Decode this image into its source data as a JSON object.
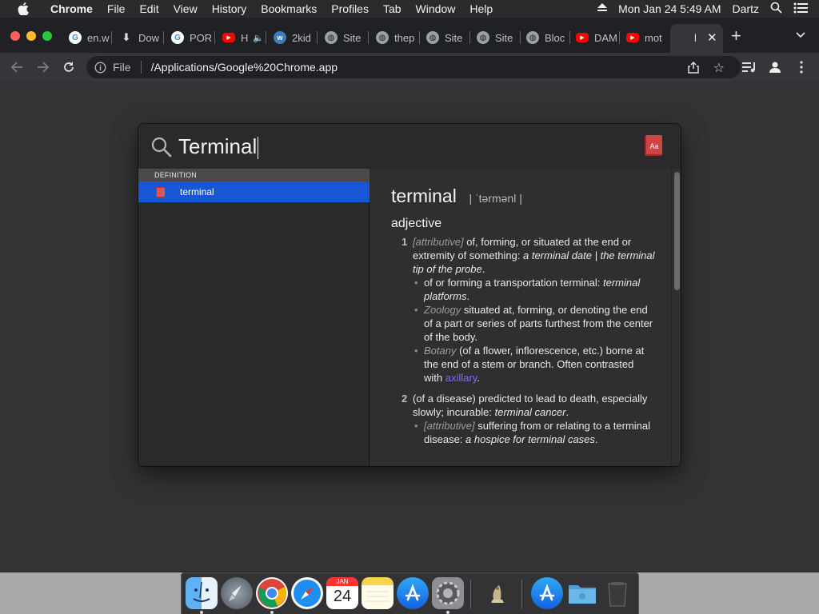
{
  "menubar": {
    "app_name": "Chrome",
    "menus": [
      "File",
      "Edit",
      "View",
      "History",
      "Bookmarks",
      "Profiles",
      "Tab",
      "Window",
      "Help"
    ],
    "clock": "Mon Jan 24  5:49 AM",
    "user": "Dartz"
  },
  "tabs": [
    {
      "label": "en.w",
      "icon": "google-icon"
    },
    {
      "label": "Dow",
      "icon": "download-icon"
    },
    {
      "label": "POR",
      "icon": "google-icon"
    },
    {
      "label": "H",
      "icon": "youtube-icon"
    },
    {
      "label": "2kid",
      "icon": "site-icon"
    },
    {
      "label": "Site",
      "icon": "globe-icon"
    },
    {
      "label": "thep",
      "icon": "globe-icon"
    },
    {
      "label": "Site",
      "icon": "globe-icon"
    },
    {
      "label": "Site",
      "icon": "globe-icon"
    },
    {
      "label": "Bloc",
      "icon": "globe-icon"
    },
    {
      "label": "DAM",
      "icon": "youtube-icon"
    },
    {
      "label": "mot",
      "icon": "youtube-icon"
    },
    {
      "label": "l",
      "icon": "blank-icon"
    }
  ],
  "omnibox": {
    "scheme_label": "File",
    "url": "/Applications/Google%20Chrome.app"
  },
  "spotlight": {
    "query": "Terminal",
    "section_header": "DEFINITION",
    "result_label": "terminal"
  },
  "dictionary": {
    "headword": "terminal",
    "pronunciation": "| ˈtərmənl |",
    "pos": "adjective",
    "sense1": {
      "num": "1",
      "label": "[attributive]",
      "text": " of, forming, or situated at the end or extremity of something: ",
      "example": "a terminal date | the terminal tip of the probe",
      "end": "."
    },
    "sense1_sub1": {
      "text": "of or forming a transportation terminal: ",
      "example": "terminal platforms",
      "end": "."
    },
    "sense1_sub2": {
      "label": "Zoology",
      "text": " situated at, forming, or denoting the end of a part or series of parts furthest from the center of the body."
    },
    "sense1_sub3": {
      "label": "Botany",
      "text": " (of a flower, inflorescence, etc.) borne at the end of a stem or branch. Often contrasted with ",
      "xref": "axillary",
      "end": "."
    },
    "sense2": {
      "num": "2",
      "text": "(of a disease) predicted to lead to death, especially slowly; incurable: ",
      "example": "terminal cancer",
      "end": "."
    },
    "sense2_sub1": {
      "label": "[attributive]",
      "text": " suffering from or relating to a terminal disease: ",
      "example": "a hospice for terminal cases",
      "end": "."
    }
  },
  "dock": {
    "apps": [
      "finder-icon",
      "launchpad-icon",
      "chrome-icon",
      "safari-icon",
      "calendar-icon",
      "notes-icon",
      "app-store-icon",
      "system-preferences-icon",
      "chess-icon",
      "app-store-folder-icon",
      "folder-icon",
      "trash-icon"
    ],
    "calendar_month": "JAN",
    "calendar_day": "24"
  },
  "colors": {
    "selection": "#1757d5",
    "link": "#7a6cf2",
    "desktop": "#a9a9ac"
  }
}
